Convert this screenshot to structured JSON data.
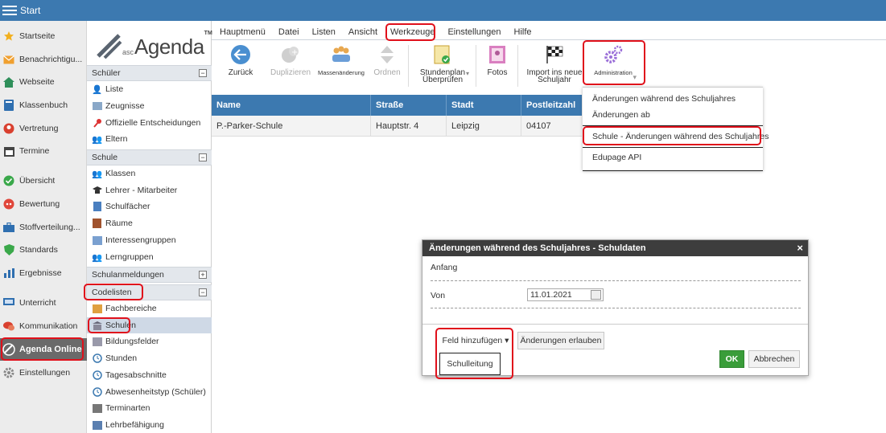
{
  "topbar": {
    "title": "Start"
  },
  "leftnav": {
    "items": [
      {
        "label": "Startseite",
        "icon": "star-icon"
      },
      {
        "label": "Benachrichtigu...",
        "icon": "envelope-icon"
      },
      {
        "label": "Webseite",
        "icon": "house-icon"
      },
      {
        "label": "Klassenbuch",
        "icon": "book-icon"
      },
      {
        "label": "Vertretung",
        "icon": "person-icon"
      },
      {
        "label": "Termine",
        "icon": "calendar-icon"
      },
      {
        "label": "Übersicht",
        "icon": "check-circle-icon"
      },
      {
        "label": "Bewertung",
        "icon": "rating-icon"
      },
      {
        "label": "Stoffverteilung...",
        "icon": "briefcase-icon"
      },
      {
        "label": "Standards",
        "icon": "shield-check-icon"
      },
      {
        "label": "Ergebnisse",
        "icon": "bar-chart-icon"
      },
      {
        "label": "Unterricht",
        "icon": "classroom-icon"
      },
      {
        "label": "Kommunikation",
        "icon": "chat-icon"
      },
      {
        "label": "Agenda Online",
        "icon": "agenda-logo-icon"
      },
      {
        "label": "Einstellungen",
        "icon": "gear-icon"
      }
    ]
  },
  "logo": {
    "prefix": "asc",
    "word": "Agenda",
    "tm": "TM"
  },
  "sections": {
    "schueler": {
      "title": "Schüler",
      "items": [
        "Liste",
        "Zeugnisse",
        "Offizielle Entscheidungen",
        "Eltern"
      ]
    },
    "schule": {
      "title": "Schule",
      "items": [
        "Klassen",
        "Lehrer - Mitarbeiter",
        "Schulfächer",
        "Räume",
        "Interessengruppen",
        "Lerngruppen"
      ]
    },
    "schulanmeldungen": {
      "title": "Schulanmeldungen"
    },
    "codelisten": {
      "title": "Codelisten",
      "items": [
        "Fachbereiche",
        "Schulen",
        "Bildungsfelder",
        "Stunden",
        "Tagesabschnitte",
        "Abwesenheitstyp (Schüler)",
        "Terminarten",
        "Lehrbefähigung"
      ]
    }
  },
  "menubar": [
    "Hauptmenü",
    "Datei",
    "Listen",
    "Ansicht",
    "Werkzeuge",
    "Einstellungen",
    "Hilfe"
  ],
  "toolbar": {
    "back": "Zurück",
    "duplicate": "Duplizieren",
    "mass_change": "Massenänderung",
    "order": "Ordnen",
    "timetable_1": "Stundenplan",
    "timetable_2": "Überprüfen",
    "photos": "Fotos",
    "import_1": "Import ins neue",
    "import_2": "Schuljahr",
    "administration": "Administration"
  },
  "table": {
    "headers": [
      "Name",
      "Straße",
      "Stadt",
      "Postleitzahl"
    ],
    "rows": [
      [
        "P.-Parker-Schule",
        "Hauptstr. 4",
        "Leipzig",
        "04107"
      ]
    ]
  },
  "dropdown": {
    "items": [
      "Änderungen während des Schuljahres",
      "Änderungen ab",
      "Schule - Änderungen während des Schuljahres",
      "Edupage API"
    ]
  },
  "dialog": {
    "title": "Änderungen während des Schuljahres - Schuldaten",
    "anfang": "Anfang",
    "von_label": "Von",
    "von_value": "11.01.2021",
    "add_field": "Feld hinzufügen ▾",
    "allow_changes": "Änderungen erlauben",
    "option_schulleitung": "Schulleitung",
    "ok": "OK",
    "cancel": "Abbrechen",
    "close": "×"
  },
  "colors": {
    "header_blue": "#3c79b0",
    "highlight_red": "#e0101b",
    "ok_green": "#3a9d3a",
    "dialog_header": "#3d3d3d"
  }
}
